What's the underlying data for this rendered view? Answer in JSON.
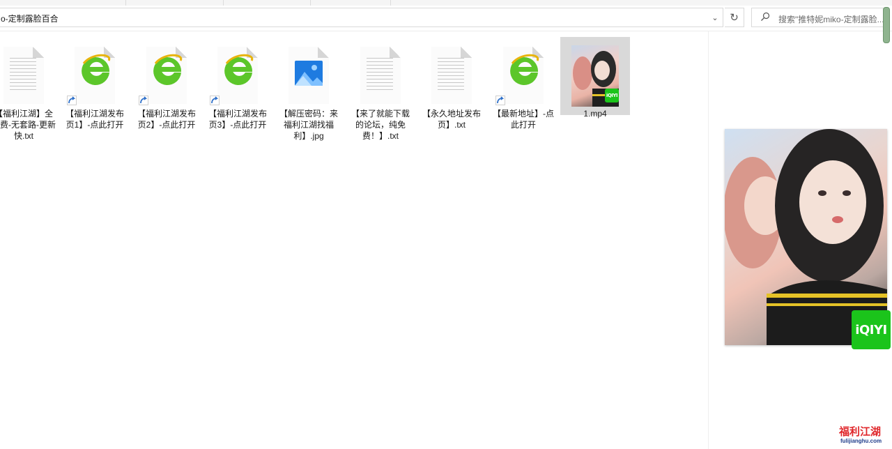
{
  "window": {
    "address_path": "o-定制露脸百合",
    "search_placeholder": "搜索\"推特妮miko-定制露脸..."
  },
  "files": [
    {
      "label": "【福利江湖】全免费-无套路-更新快.txt",
      "icon": "text-file-icon",
      "shortcut": false
    },
    {
      "label": "【福利江湖发布页1】-点此打开",
      "icon": "ie-browser-icon",
      "shortcut": true
    },
    {
      "label": "【福利江湖发布页2】-点此打开",
      "icon": "ie-browser-icon",
      "shortcut": true
    },
    {
      "label": "【福利江湖发布页3】-点此打开",
      "icon": "ie-browser-icon",
      "shortcut": true
    },
    {
      "label": "【解压密码：来福利江湖找福利】.jpg",
      "icon": "image-file-icon",
      "shortcut": false
    },
    {
      "label": "【来了就能下载的论坛，纯免费！】.txt",
      "icon": "text-file-icon",
      "shortcut": false
    },
    {
      "label": "【永久地址发布页】.txt",
      "icon": "text-file-icon",
      "shortcut": false
    },
    {
      "label": "【最新地址】-点此打开",
      "icon": "ie-browser-icon",
      "shortcut": true
    },
    {
      "label": "1.mp4",
      "icon": "video-thumbnail",
      "shortcut": false,
      "selected": true,
      "badge": "iQIYI"
    }
  ],
  "preview": {
    "badge": "iQIYI"
  },
  "watermark": {
    "title": "福利江湖",
    "url": "fulijianghu.com"
  },
  "colors": {
    "iqiyi_green": "#1bc41b",
    "ie_green": "#5cc62a",
    "watermark_blue": "#1e64c8",
    "watermark_red": "#e0262a"
  }
}
